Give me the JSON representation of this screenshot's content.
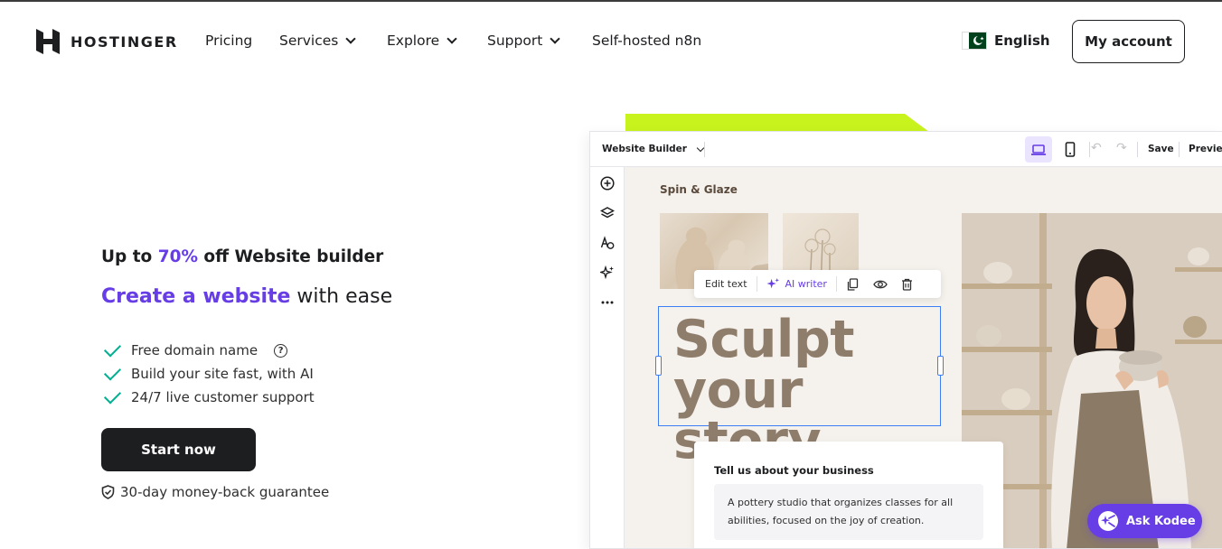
{
  "header": {
    "logo_text": "HOSTINGER",
    "nav": [
      {
        "label": "Pricing",
        "dropdown": false
      },
      {
        "label": "Services",
        "dropdown": true
      },
      {
        "label": "Explore",
        "dropdown": true
      },
      {
        "label": "Support",
        "dropdown": true
      },
      {
        "label": "Self-hosted n8n",
        "dropdown": false
      }
    ],
    "language": "English",
    "language_flag_icon": "pakistan-flag-icon",
    "account_button": "My account"
  },
  "hero": {
    "promo_prefix": "Up to ",
    "promo_discount": "70%",
    "promo_suffix": " off Website builder",
    "headline_accent": "Create a website",
    "headline_rest": " with ease",
    "features": [
      {
        "text": "Free domain name",
        "help_icon": true
      },
      {
        "text": "Build your site fast, with AI",
        "help_icon": false
      },
      {
        "text": "24/7 live customer support",
        "help_icon": false
      }
    ],
    "cta": "Start now",
    "guarantee": "30-day money-back guarantee"
  },
  "builder": {
    "title": "Website Builder",
    "save": "Save",
    "preview": "Preview",
    "site_name": "Spin & Glaze",
    "edit_text": "Edit text",
    "ai_writer": "AI writer",
    "heading_line1": "Sculpt",
    "heading_line2": "your story",
    "card_title": "Tell us about your business",
    "card_text": "A pottery studio that organizes classes for all abilities, focused on the joy of creation."
  },
  "assistant": {
    "label": "Ask Kodee"
  },
  "colors": {
    "accent": "#673de6",
    "check": "#00b090",
    "lime": "#c9f31d",
    "selection": "#3d7ef6"
  }
}
